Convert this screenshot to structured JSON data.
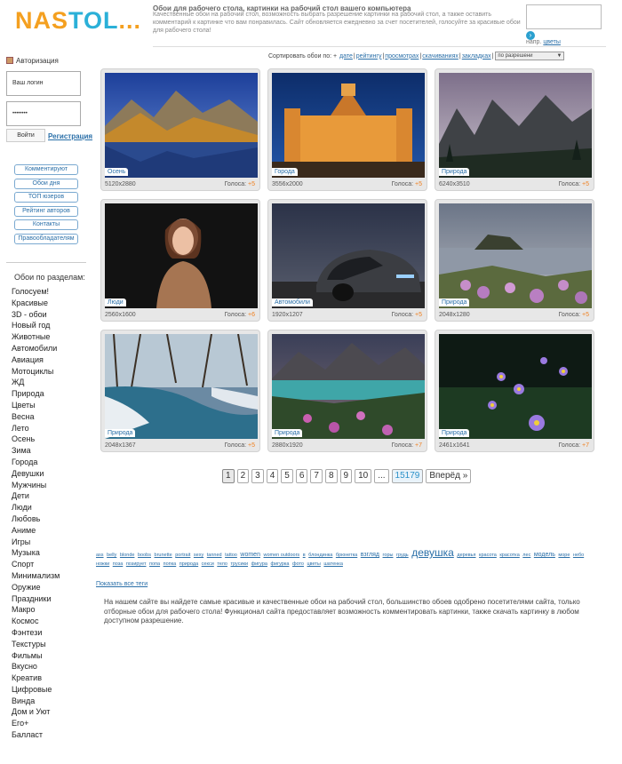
{
  "header": {
    "logo": {
      "part1": "NAS",
      "part2": "TOL",
      "part3": "..."
    },
    "title": "Обои для рабочего стола, картинки на рабочий стол вашего компьютера",
    "description": "Качественные обои на рабочий стол, возможность выбрать разрешение картинки на рабочий стол, а также оставить комментарий к картинке что вам понравилась. Сайт обновляется ежедневно за счет посетителей, голосуйте за красивые обои для рабочего стола!",
    "search_hint_prefix": "напр.",
    "search_hint_link": "цветы"
  },
  "sort": {
    "label": "Сортировать обои по:",
    "plus": "+",
    "items": [
      "дате",
      "рейтингу",
      "просмотрах",
      "скачиваниях",
      "закладках"
    ],
    "separator": "|",
    "resolution_select": "по разрешени"
  },
  "auth": {
    "title": "Авторизация",
    "login_placeholder": "Ваш логин",
    "password_value": "••••••••",
    "login_button": "Войти",
    "register_link": "Регистрация"
  },
  "side_buttons": [
    "Комментируют",
    "Обои дня",
    "ТОП юзеров",
    "Рейтинг авторов",
    "Контакты",
    "Правообладателям"
  ],
  "sections": {
    "title": "Обои по разделам:",
    "items": [
      "Голосуем!",
      "Красивые",
      "3D - обои",
      "Новый год",
      "Животные",
      "Автомобили",
      "Авиация",
      "Мотоциклы",
      "ЖД",
      "Природа",
      "Цветы",
      "Весна",
      "Лето",
      "Осень",
      "Зима",
      "Города",
      "Девушки",
      "Мужчины",
      "Дети",
      "Люди",
      "Любовь",
      "Аниме",
      "Игры",
      "Музыка",
      "Спорт",
      "Минимализм",
      "Оружие",
      "Праздники",
      "Макро",
      "Космос",
      "Фэнтези",
      "Текстуры",
      "Фильмы",
      "Вкусно",
      "Креатив",
      "Цифровые",
      "Винда",
      "Дом и Уют",
      "Его+",
      "Балласт"
    ]
  },
  "thumbs": [
    {
      "category": "Осень",
      "resolution": "5120x2880",
      "votes_label": "Голоса:",
      "votes": "+5"
    },
    {
      "category": "Города",
      "resolution": "3556x2000",
      "votes_label": "Голоса:",
      "votes": "+5"
    },
    {
      "category": "Природа",
      "resolution": "6240x3510",
      "votes_label": "Голоса:",
      "votes": "+5"
    },
    {
      "category": "Люди",
      "resolution": "2560x1600",
      "votes_label": "Голоса:",
      "votes": "+6"
    },
    {
      "category": "Автомобили",
      "resolution": "1920x1207",
      "votes_label": "Голоса:",
      "votes": "+5"
    },
    {
      "category": "Природа",
      "resolution": "2048x1280",
      "votes_label": "Голоса:",
      "votes": "+5"
    },
    {
      "category": "Природа",
      "resolution": "2048x1367",
      "votes_label": "Голоса:",
      "votes": "+5"
    },
    {
      "category": "Природа",
      "resolution": "2880x1920",
      "votes_label": "Голоса:",
      "votes": "+7"
    },
    {
      "category": "Природа",
      "resolution": "2461x1641",
      "votes_label": "Голоса:",
      "votes": "+7"
    }
  ],
  "pagination": {
    "pages": [
      "1",
      "2",
      "3",
      "4",
      "5",
      "6",
      "7",
      "8",
      "9",
      "10"
    ],
    "ellipsis": "...",
    "last": "15179",
    "next": "Вперёд »"
  },
  "tags": [
    {
      "t": "ass",
      "s": 1
    },
    {
      "t": "belly",
      "s": 1
    },
    {
      "t": "blonde",
      "s": 1
    },
    {
      "t": "boobs",
      "s": 1
    },
    {
      "t": "brunette",
      "s": 1
    },
    {
      "t": "portrait",
      "s": 1
    },
    {
      "t": "sexy",
      "s": 1
    },
    {
      "t": "tanned",
      "s": 1
    },
    {
      "t": "tattoo",
      "s": 1
    },
    {
      "t": "women",
      "s": 2
    },
    {
      "t": "women outdoors",
      "s": 1
    },
    {
      "t": "в",
      "s": 1
    },
    {
      "t": "блондинка",
      "s": 1
    },
    {
      "t": "брюнетка",
      "s": 1
    },
    {
      "t": "взгляд",
      "s": 2
    },
    {
      "t": "горы",
      "s": 1
    },
    {
      "t": "грудь",
      "s": 1
    },
    {
      "t": "девушка",
      "s": 4
    },
    {
      "t": "деревья",
      "s": 1
    },
    {
      "t": "красота",
      "s": 1
    },
    {
      "t": "красотка",
      "s": 1
    },
    {
      "t": "лес",
      "s": 1
    },
    {
      "t": "модель",
      "s": 2
    },
    {
      "t": "море",
      "s": 1
    },
    {
      "t": "небо",
      "s": 1
    },
    {
      "t": "ножки",
      "s": 1
    },
    {
      "t": "поза",
      "s": 1
    },
    {
      "t": "позирует",
      "s": 1
    },
    {
      "t": "попа",
      "s": 1
    },
    {
      "t": "попка",
      "s": 1
    },
    {
      "t": "природа",
      "s": 1
    },
    {
      "t": "секси",
      "s": 1
    },
    {
      "t": "тело",
      "s": 1
    },
    {
      "t": "трусики",
      "s": 1
    },
    {
      "t": "фигура",
      "s": 1
    },
    {
      "t": "фигурка",
      "s": 1
    },
    {
      "t": "фото",
      "s": 1
    },
    {
      "t": "цветы",
      "s": 1
    },
    {
      "t": "шатенка",
      "s": 1
    }
  ],
  "show_all_tags": "Показать все теги",
  "about": "На нашем сайте вы найдете самые красивые и качественные обои на рабочий стол, большинство обоев одобрено посетителями сайта, только отборные обои для рабочего стола! Функционал сайта предоставляет возможность комментировать картинки, также скачать картинку в любом доступном разрешение."
}
